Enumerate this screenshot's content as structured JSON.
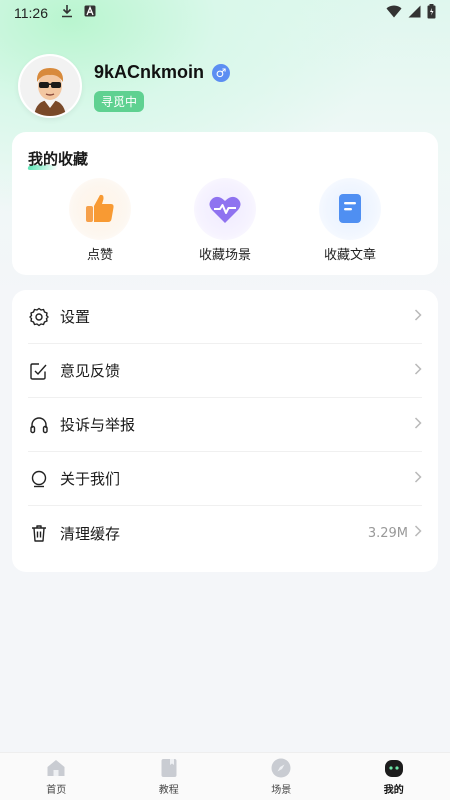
{
  "status_bar": {
    "time": "11:26",
    "icons_left": [
      "download-icon",
      "a-badge-icon"
    ],
    "icons_right": [
      "wifi-icon",
      "signal-icon",
      "battery-icon"
    ]
  },
  "profile": {
    "username": "9kACnkmoin",
    "gender_symbol": "♂",
    "status_tag": "寻觅中",
    "avatar_icon": "avatar-cartoon-sunglasses"
  },
  "favorites": {
    "title": "我的收藏",
    "items": [
      {
        "label": "点赞",
        "icon": "thumbs-up-icon",
        "color": "#f89a33"
      },
      {
        "label": "收藏场景",
        "icon": "heart-pulse-icon",
        "color": "#8f73f0"
      },
      {
        "label": "收藏文章",
        "icon": "document-icon",
        "color": "#4f8ff2"
      }
    ]
  },
  "menu": {
    "items": [
      {
        "label": "设置",
        "icon": "gear-icon"
      },
      {
        "label": "意见反馈",
        "icon": "feedback-edit-icon"
      },
      {
        "label": "投诉与举报",
        "icon": "headphones-icon"
      },
      {
        "label": "关于我们",
        "icon": "about-bubble-icon"
      },
      {
        "label": "清理缓存",
        "icon": "trash-icon",
        "value": "3.29M"
      }
    ]
  },
  "bottom_nav": {
    "items": [
      {
        "label": "首页",
        "icon": "home-icon"
      },
      {
        "label": "教程",
        "icon": "book-icon"
      },
      {
        "label": "场景",
        "icon": "compass-icon"
      },
      {
        "label": "我的",
        "icon": "robot-face-icon",
        "active": true
      }
    ]
  },
  "colors": {
    "accent_green": "#5fd191",
    "gender_blue": "#5c8ef2",
    "background": "#f4f6f9"
  }
}
